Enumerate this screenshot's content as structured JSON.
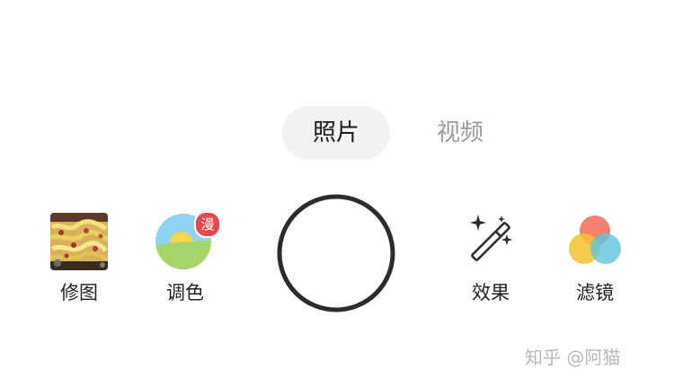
{
  "mode_tabs": {
    "photo_label": "照片",
    "video_label": "视频",
    "selected": "照片"
  },
  "tools_left": [
    {
      "label": "修图",
      "icon": "photo-thumbnail-icon"
    },
    {
      "label": "调色",
      "icon": "landscape-color-icon",
      "badge": "漫"
    }
  ],
  "tools_right": [
    {
      "label": "效果",
      "icon": "magic-wand-icon"
    },
    {
      "label": "滤镜",
      "icon": "filter-circles-icon"
    }
  ],
  "shutter": {
    "icon": "shutter-ring-icon"
  },
  "watermark": "知乎 @阿猫",
  "colors": {
    "tab_selected_bg": "#f2f2f2",
    "tab_inactive_text": "#9a9a9a",
    "badge_red": "#e9474f",
    "filter_red": "#f26b57",
    "filter_yellow": "#f5c12e",
    "filter_cyan": "#5cc6dc",
    "sky_blue": "#8fd3f2",
    "grass_green": "#a6d66a",
    "sun_yellow": "#f6d64b"
  }
}
